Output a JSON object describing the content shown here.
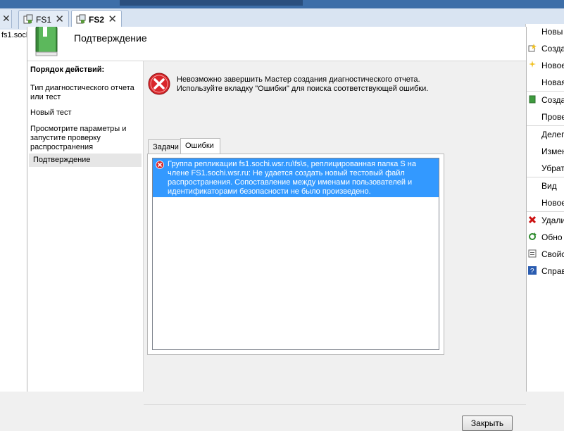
{
  "tabs": [
    {
      "label": "FS1",
      "active": false
    },
    {
      "label": "FS2",
      "active": true
    }
  ],
  "left_tree_item": "fs1.soch",
  "dialog": {
    "title": "Подтверждение",
    "steps_header": "Порядок действий:",
    "steps": [
      "Тип диагностического отчета или тест",
      "Новый тест",
      "Просмотрите параметры и запустите проверку распространения",
      "Подтверждение"
    ],
    "current_step": 3,
    "error_message_line1": "Невозможно завершить Мастер создания диагностического отчета.",
    "error_message_line2": "Используйте вкладку \"Ошибки\" для поиска соответствующей ошибки.",
    "panel_tabs": [
      "Задачи",
      "Ошибки"
    ],
    "selected_panel_tab": 1,
    "errors": [
      "Группа репликации fs1.sochi.wsr.ru\\fs\\s, реплицированная папка S на члене FS1.sochi.wsr.ru: Не удается создать новый тестовый файл распространения. Сопоставление между именами пользователей и идентификаторами безопасности не было произведено."
    ],
    "close_label": "Закрыть"
  },
  "actions": [
    {
      "label": "Новы",
      "icon": "none"
    },
    {
      "label": "Созда",
      "icon": "new-item-icon"
    },
    {
      "label": "Новое",
      "icon": "sparkle-icon"
    },
    {
      "label": "Новая",
      "icon": "none"
    },
    {
      "label": "Созда",
      "icon": "create-green-icon"
    },
    {
      "label": "Прове",
      "icon": "none"
    },
    {
      "label": "Делег",
      "icon": "none"
    },
    {
      "label": "Измен",
      "icon": "none"
    },
    {
      "label": "Убрат",
      "icon": "none"
    },
    {
      "label": "Вид",
      "icon": "none"
    },
    {
      "label": "Новое",
      "icon": "none"
    },
    {
      "label": "Удали",
      "icon": "delete-icon"
    },
    {
      "label": "Обно",
      "icon": "refresh-icon"
    },
    {
      "label": "Свойс",
      "icon": "properties-icon"
    },
    {
      "label": "Справ",
      "icon": "help-icon"
    }
  ],
  "colors": {
    "selection": "#3399ff",
    "error_red": "#d9262a",
    "accent_blue": "#3d6ea8"
  }
}
